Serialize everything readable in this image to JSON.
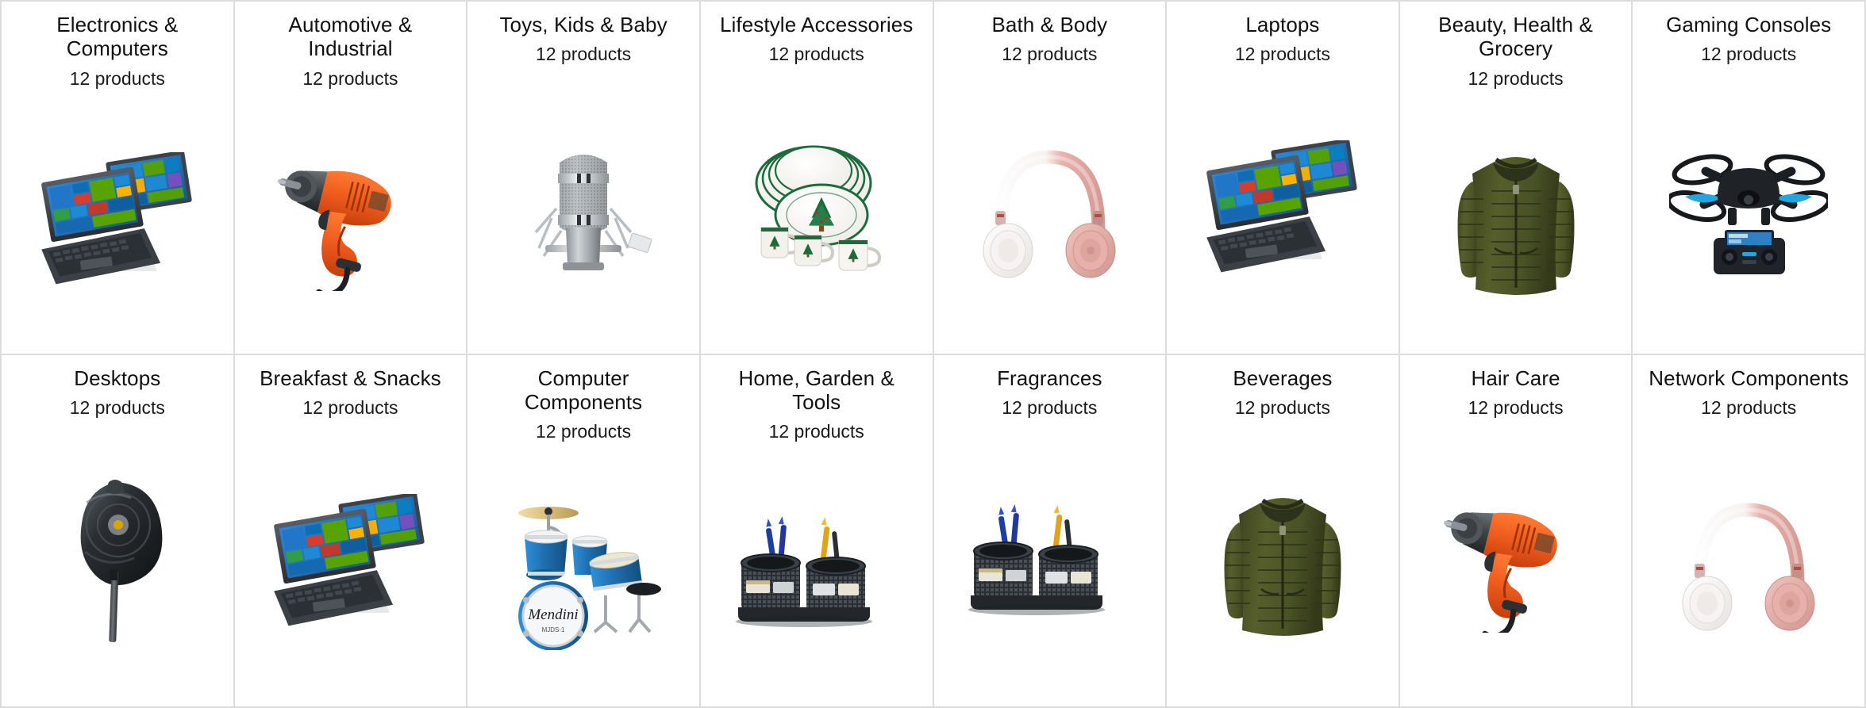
{
  "page": {
    "title": "Product Categories Grid",
    "columns": 8,
    "rows": 2,
    "border_color": "#dcdcdc",
    "background_color": "#ffffff",
    "count_suffix": "products"
  },
  "categories": [
    {
      "name": "Electronics & Computers",
      "count_label": "12 products",
      "count": 12,
      "image": "convertible-laptop-windows"
    },
    {
      "name": "Automotive & Industrial",
      "count_label": "12 products",
      "count": 12,
      "image": "orange-power-drill"
    },
    {
      "name": "Toys, Kids & Baby",
      "count_label": "12 products",
      "count": 12,
      "image": "condenser-microphone"
    },
    {
      "name": "Lifestyle Accessories",
      "count_label": "12 products",
      "count": 12,
      "image": "christmas-tree-dinnerware"
    },
    {
      "name": "Bath & Body",
      "count_label": "12 products",
      "count": 12,
      "image": "rose-gold-headphones"
    },
    {
      "name": "Laptops",
      "count_label": "12 products",
      "count": 12,
      "image": "convertible-laptop-windows"
    },
    {
      "name": "Beauty, Health & Grocery",
      "count_label": "12 products",
      "count": 12,
      "image": "olive-puffer-jacket"
    },
    {
      "name": "Gaming Consoles",
      "count_label": "12 products",
      "count": 12,
      "image": "quadcopter-drone-controller"
    },
    {
      "name": "Desktops",
      "count_label": "12 products",
      "count": 12,
      "image": "golf-driver-club"
    },
    {
      "name": "Breakfast & Snacks",
      "count_label": "12 products",
      "count": 12,
      "image": "convertible-laptop-windows"
    },
    {
      "name": "Computer Components",
      "count_label": "12 products",
      "count": 12,
      "image": "blue-junior-drum-set"
    },
    {
      "name": "Home, Garden & Tools",
      "count_label": "12 products",
      "count": 12,
      "image": "mesh-desk-organizer"
    },
    {
      "name": "Fragrances",
      "count_label": "12 products",
      "count": 12,
      "image": "mesh-desk-organizer"
    },
    {
      "name": "Beverages",
      "count_label": "12 products",
      "count": 12,
      "image": "olive-puffer-jacket"
    },
    {
      "name": "Hair Care",
      "count_label": "12 products",
      "count": 12,
      "image": "orange-power-drill"
    },
    {
      "name": "Network Components",
      "count_label": "12 products",
      "count": 12,
      "image": "rose-gold-headphones"
    }
  ],
  "colors": {
    "drill_orange": "#ee5b1d",
    "jacket_olive": "#4a5226",
    "headphone_rose": "#e8b3ad",
    "drum_blue": "#1f6fb0",
    "drone_accent": "#1fa8e0",
    "tile_blue": "#1e8ad6",
    "tile_green": "#57a300",
    "dish_green": "#1d6b3c"
  }
}
